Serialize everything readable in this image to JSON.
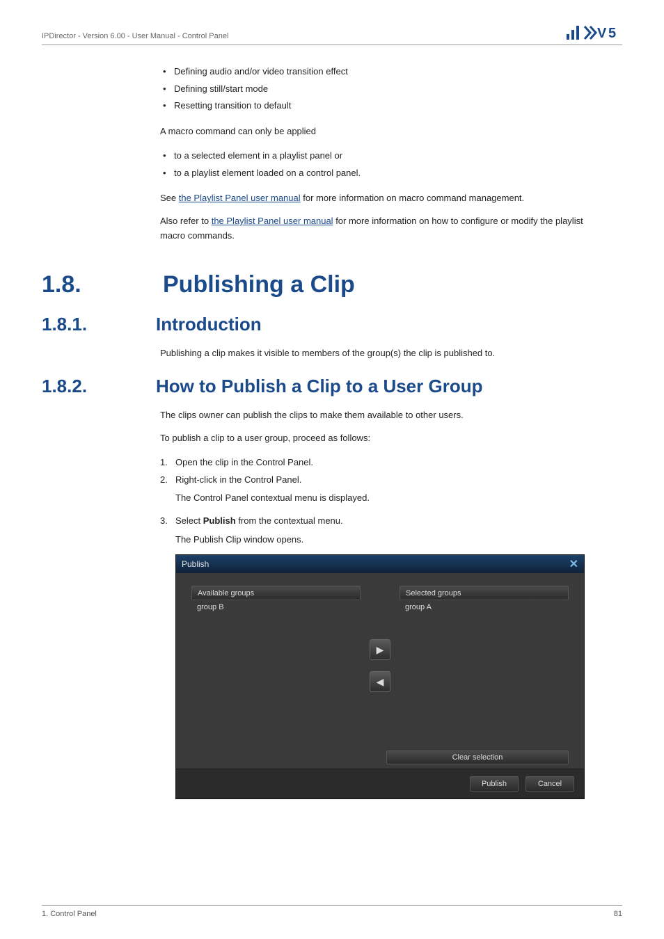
{
  "header": {
    "breadcrumb": "IPDirector - Version 6.00 - User Manual - Control Panel",
    "logo_alt": "EVS"
  },
  "intro_bullets": [
    "Defining audio and/or video transition effect",
    "Defining still/start mode",
    "Resetting transition to default"
  ],
  "para_macro_intro": "A macro command can only be applied",
  "apply_bullets": [
    "to a selected element in a playlist panel or",
    "to a playlist element loaded on a control panel."
  ],
  "see_prefix": "See ",
  "see_link": "the Playlist Panel user manual",
  "see_suffix": " for more information on macro command management.",
  "also_prefix": "Also refer to ",
  "also_link": "the Playlist Panel user manual",
  "also_suffix": " for more information on how to configure or modify the playlist macro commands.",
  "h1": {
    "num": "1.8.",
    "text": "Publishing a Clip"
  },
  "h2a": {
    "num": "1.8.1.",
    "text": "Introduction"
  },
  "intro_para": "Publishing a clip makes it visible to members of the group(s) the clip is published to.",
  "h2b": {
    "num": "1.8.2.",
    "text": "How to Publish a Clip to a User Group"
  },
  "howto_lead1": "The clips owner can publish the clips to make them available to other users.",
  "howto_lead2": "To publish a clip to a user group, proceed as follows:",
  "steps": {
    "s1": {
      "num": "1.",
      "text": "Open the clip in the Control Panel."
    },
    "s2": {
      "num": "2.",
      "text": "Right-click in the Control Panel."
    },
    "s2_sub": "The Control Panel contextual menu is displayed.",
    "s3_num": "3.",
    "s3_prefix": "Select ",
    "s3_bold": "Publish",
    "s3_suffix": " from the contextual menu.",
    "s3_sub": "The Publish Clip window opens."
  },
  "dialog": {
    "title": "Publish",
    "close": "✕",
    "available_head": "Available groups",
    "available_item": "group B",
    "selected_head": "Selected groups",
    "selected_item": "group A",
    "arrow_right": "▶",
    "arrow_left": "◀",
    "clear": "Clear selection",
    "publish": "Publish",
    "cancel": "Cancel"
  },
  "footer": {
    "left": "1. Control Panel",
    "right": "81"
  }
}
